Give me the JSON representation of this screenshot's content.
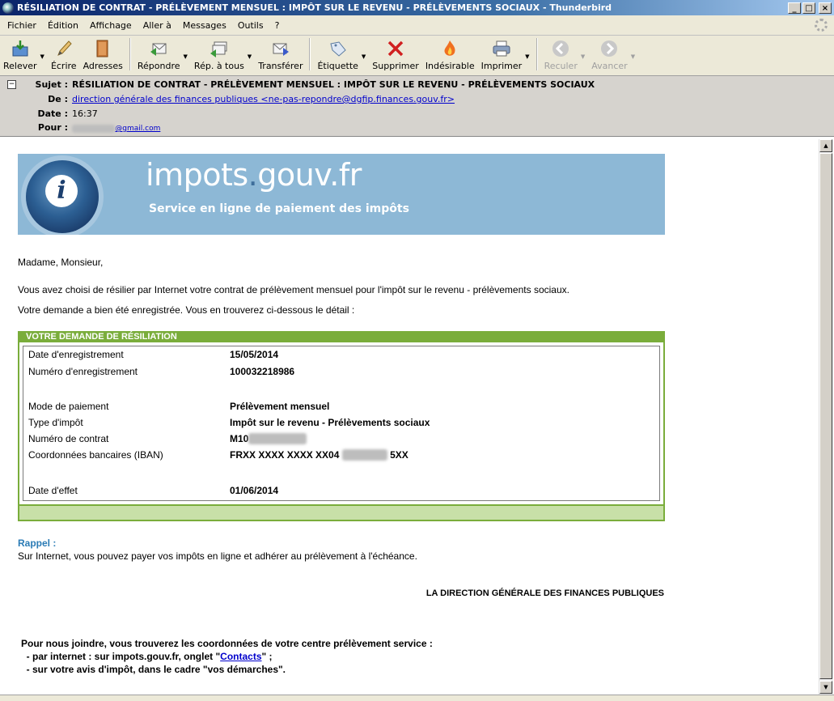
{
  "window": {
    "title": "RÉSILIATION DE CONTRAT - PRÉLÈVEMENT MENSUEL : IMPÔT SUR LE REVENU - PRÉLÈVEMENTS SOCIAUX - Thunderbird",
    "min": "_",
    "max": "□",
    "close": "×"
  },
  "menu": [
    {
      "label": "Fichier"
    },
    {
      "label": "Édition"
    },
    {
      "label": "Affichage"
    },
    {
      "label": "Aller à"
    },
    {
      "label": "Messages"
    },
    {
      "label": "Outils"
    },
    {
      "label": "?"
    }
  ],
  "toolbar": {
    "relever": "Relever",
    "ecrire": "Écrire",
    "adresses": "Adresses",
    "repondre": "Répondre",
    "rep_tous": "Rép. à tous",
    "transferer": "Transférer",
    "etiquette": "Étiquette",
    "supprimer": "Supprimer",
    "indesirable": "Indésirable",
    "imprimer": "Imprimer",
    "reculer": "Reculer",
    "avancer": "Avancer"
  },
  "header": {
    "subject_label": "Sujet :",
    "subject": "RÉSILIATION DE CONTRAT - PRÉLÈVEMENT MENSUEL : IMPÔT SUR LE REVENU - PRÉLÈVEMENTS SOCIAUX",
    "from_label": "De :",
    "from": "direction générale des finances publiques <ne-pas-repondre@dgfip.finances.gouv.fr>",
    "date_label": "Date :",
    "date": "16:37",
    "to_label": "Pour :",
    "to_visible": "@gmail.com"
  },
  "banner": {
    "site_a": "impots",
    "site_dot": ".",
    "site_b": "gouv.fr",
    "subtitle": "Service en ligne de paiement des impôts"
  },
  "body": {
    "greeting": "Madame, Monsieur,",
    "line1": "Vous avez choisi de résilier par Internet votre contrat de prélèvement mensuel pour l'impôt sur le revenu - prélèvements sociaux.",
    "line2": "Votre demande a bien été enregistrée. Vous en trouverez ci-dessous le détail :",
    "box_title": "VOTRE DEMANDE DE RÉSILIATION",
    "rows": [
      {
        "label": "Date d'enregistrement",
        "value": "15/05/2014"
      },
      {
        "label": "Numéro d'enregistrement",
        "value": "100032218986"
      },
      {
        "label": "Mode de paiement",
        "value": "Prélèvement mensuel"
      },
      {
        "label": "Type d'impôt",
        "value": "Impôt sur le revenu - Prélèvements sociaux"
      },
      {
        "label": "Numéro de contrat",
        "value": "M10"
      },
      {
        "label": "Coordonnées bancaires (IBAN)",
        "value_a": "FRXX XXXX XXXX XX04",
        "value_b": "5XX"
      },
      {
        "label": "Date d'effet",
        "value": "01/06/2014"
      }
    ],
    "rappel_title": "Rappel :",
    "rappel_text": "Sur Internet, vous pouvez payer vos impôts en ligne et adhérer au prélèvement à l'échéance.",
    "signature": "LA DIRECTION GÉNÉRALE DES FINANCES PUBLIQUES",
    "contact_intro": "Pour nous joindre, vous trouverez les coordonnées de votre centre prélèvement service :",
    "contact_line1_a": "  - par internet : sur impots.gouv.fr, onglet \"",
    "contact_link": "Contacts",
    "contact_line1_b": "\" ;",
    "contact_line2": "  - sur votre avis d'impôt, dans le cadre \"vos démarches\"."
  }
}
